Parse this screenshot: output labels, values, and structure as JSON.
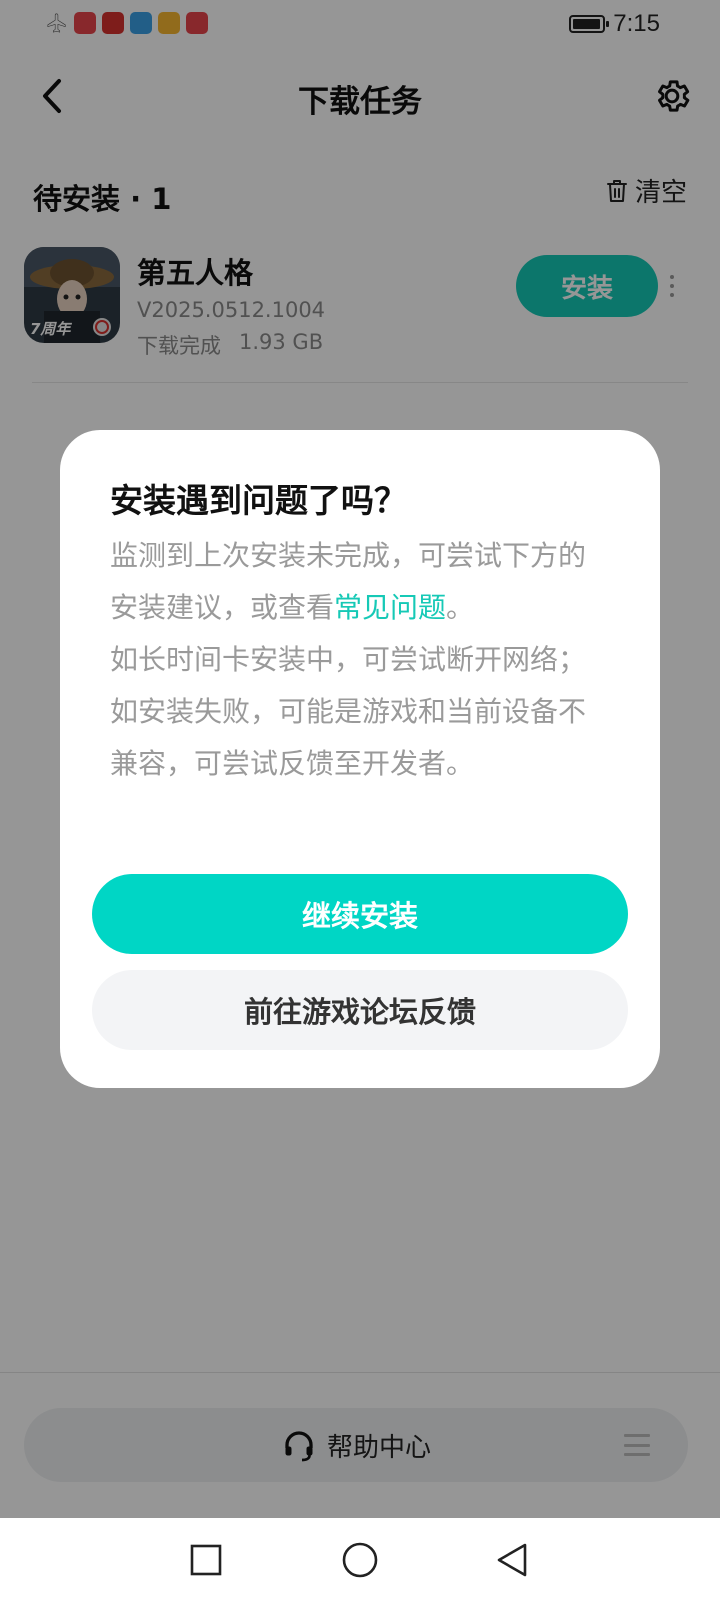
{
  "status_bar": {
    "time": "7:15",
    "battery_level": 0.95,
    "notification_icons": [
      "airplane-icon",
      "huawei-mall-icon",
      "reader-icon",
      "weather-icon",
      "tips-icon",
      "huawei-mall-icon"
    ]
  },
  "header": {
    "title": "下载任务",
    "back_icon": "chevron-left-icon",
    "settings_icon": "gear-icon"
  },
  "pending": {
    "title": "待安装 · 1",
    "clear_label": "清空",
    "clear_icon": "trash-icon"
  },
  "app": {
    "name": "第五人格",
    "version": "V2025.0512.1004",
    "status": "下载完成",
    "size": "1.93 GB",
    "install_label": "安装",
    "more_icon": "more-vertical-icon",
    "icon_badge": "7周年"
  },
  "dialog": {
    "title": "安装遇到问题了吗？",
    "body_part1": "监测到上次安装未完成，可尝试下方的安装建议，或查看",
    "faq_link": "常见问题",
    "body_part2": "。",
    "body_line2": "如长时间卡安装中，可尝试断开网络；",
    "body_line3": "如安装失败，可能是游戏和当前设备不兼容，可尝试反馈至开发者。",
    "continue_label": "继续安装",
    "forum_label": "前往游戏论坛反馈"
  },
  "bottom": {
    "help_label": "帮助中心",
    "help_icon": "headset-icon",
    "menu_icon": "menu-icon"
  },
  "nav": {
    "recent_icon": "square-icon",
    "home_icon": "circle-icon",
    "back_icon": "triangle-back-icon"
  },
  "colors": {
    "accent": "#00d6c5",
    "install_button": "#16c9b6",
    "link": "#16c9b6",
    "overlay": "rgba(0,0,0,0.41)"
  }
}
